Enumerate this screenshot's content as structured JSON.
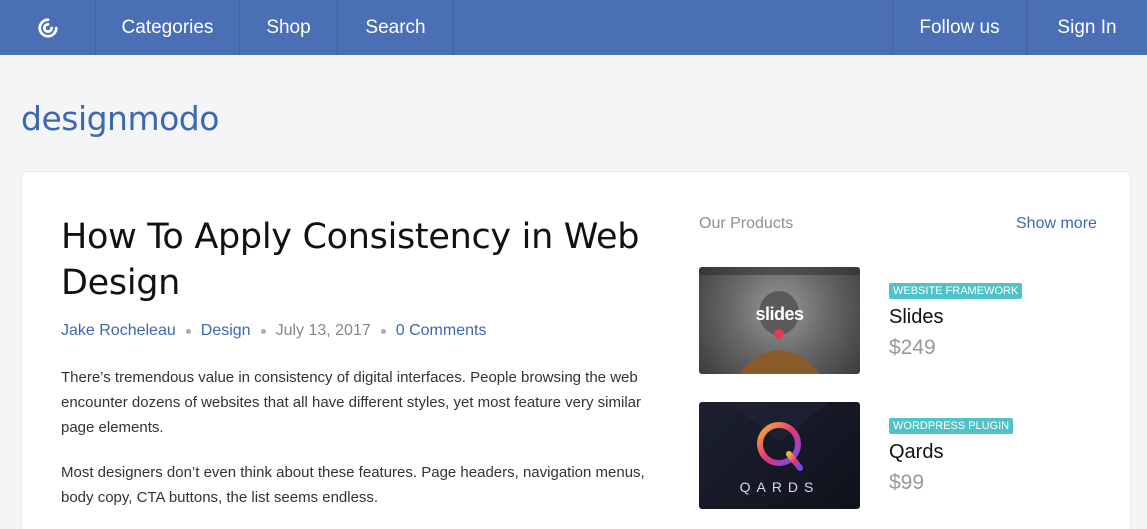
{
  "nav": {
    "categories": "Categories",
    "shop": "Shop",
    "search": "Search",
    "follow": "Follow us",
    "signin": "Sign In",
    "logo_icon": "designmodo-swirl-icon"
  },
  "brand": "designmodo",
  "article": {
    "title": "How To Apply Consistency in Web Design",
    "author": "Jake Rocheleau",
    "category": "Design",
    "date": "July 13, 2017",
    "comments": "0 Comments",
    "paragraphs": [
      "There’s tremendous value in consistency of digital interfaces. People browsing the web encounter dozens of websites that all have different styles, yet most feature very similar page elements.",
      "Most designers don’t even think about these features. Page headers, navigation menus, body copy, CTA buttons, the list seems endless."
    ]
  },
  "products": {
    "heading": "Our Products",
    "show_more": "Show more",
    "items": [
      {
        "badge": "WEBSITE FRAMEWORK",
        "name": "Slides",
        "price": "$249",
        "thumb_text": "slides"
      },
      {
        "badge": "WORDPRESS PLUGIN",
        "name": "Qards",
        "price": "$99",
        "thumb_text": "QARDS"
      }
    ]
  },
  "colors": {
    "nav_bg": "#4a6fb5",
    "brand_blue": "#3d68b0",
    "badge_teal": "#4fc3c7"
  }
}
